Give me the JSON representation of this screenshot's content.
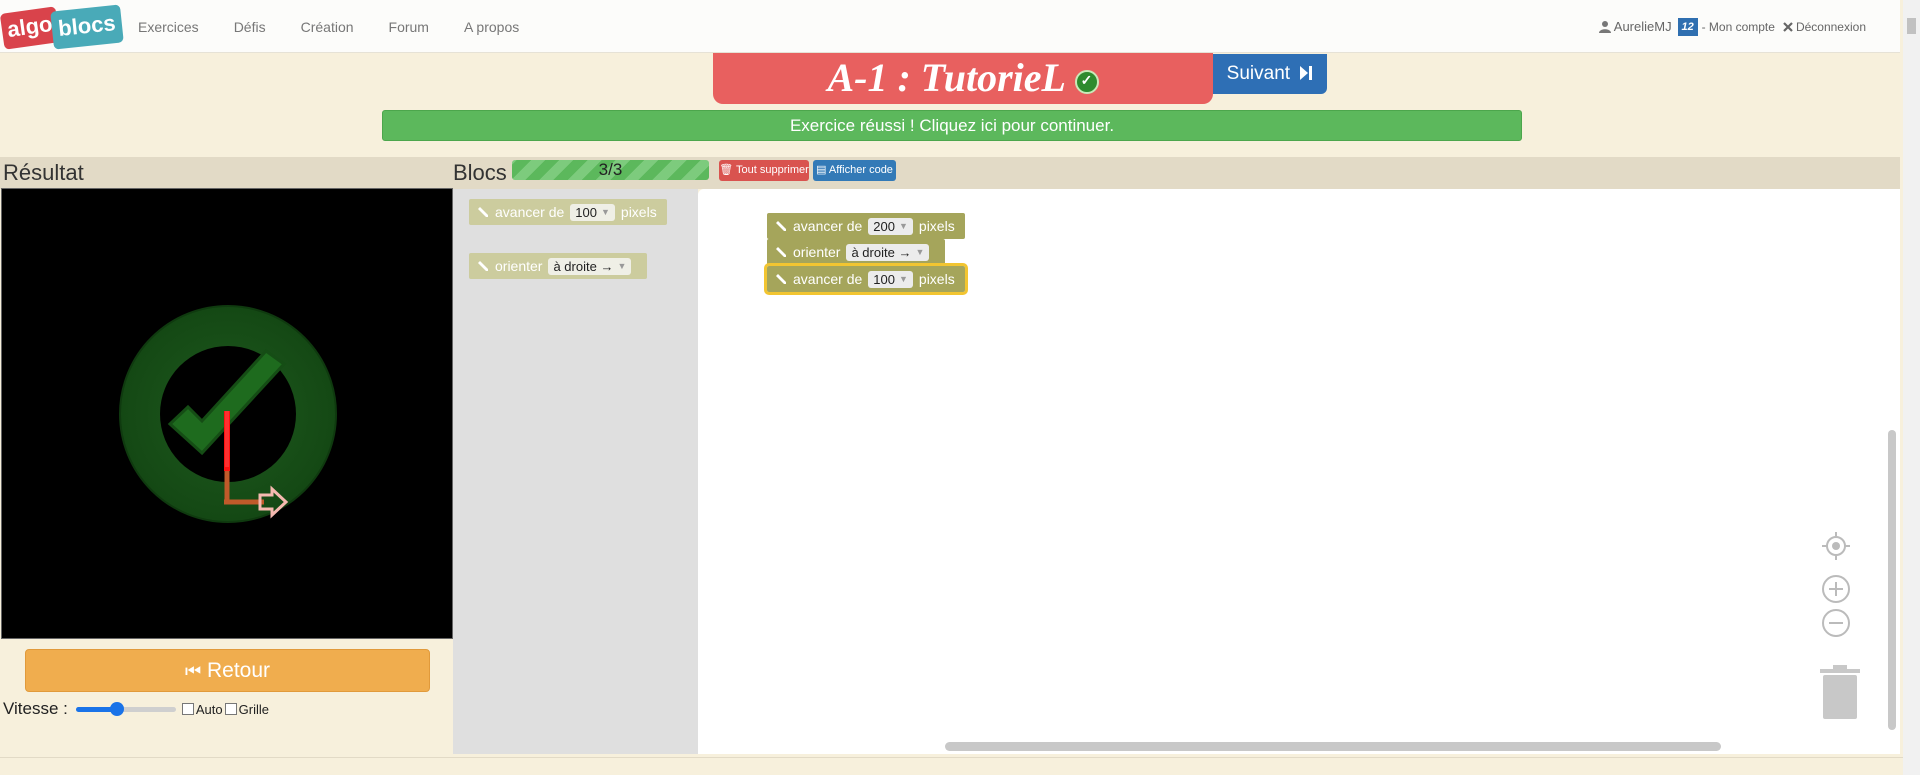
{
  "nav": {
    "logo_left": "algo",
    "logo_right": "blocs",
    "links": [
      "Exercices",
      "Défis",
      "Création",
      "Forum",
      "A propos"
    ],
    "username": "AurelieMJ",
    "badge": "12",
    "account": "- Mon compte",
    "logout": "Déconnexion"
  },
  "header": {
    "title": "A-1 : TutorieL",
    "next_label": "Suivant",
    "success_message": "Exercice réussi ! Cliquez ici pour continuer."
  },
  "result": {
    "heading": "Résultat",
    "back_label": "Retour",
    "speed_label": "Vitesse :",
    "speed_value": 0.4,
    "auto_label": "Auto",
    "grid_label": "Grille"
  },
  "blocs": {
    "heading": "Blocs",
    "progress": "3/3",
    "delete_all": "Tout supprimer",
    "show_code": "Afficher code"
  },
  "toolbox": [
    {
      "prefix": "avancer de",
      "field": "100",
      "suffix": "pixels"
    },
    {
      "prefix": "orienter",
      "field": "à droite →",
      "suffix": ""
    }
  ],
  "workspace": [
    {
      "prefix": "avancer de",
      "field": "200",
      "suffix": "pixels"
    },
    {
      "prefix": "orienter",
      "field": "à droite →",
      "suffix": ""
    },
    {
      "prefix": "avancer de",
      "field": "100",
      "suffix": "pixels"
    }
  ],
  "colors": {
    "block": "#a5a55b",
    "title_bg": "#e8605f",
    "success": "#5cb85c",
    "retour": "#f0ad4e"
  }
}
